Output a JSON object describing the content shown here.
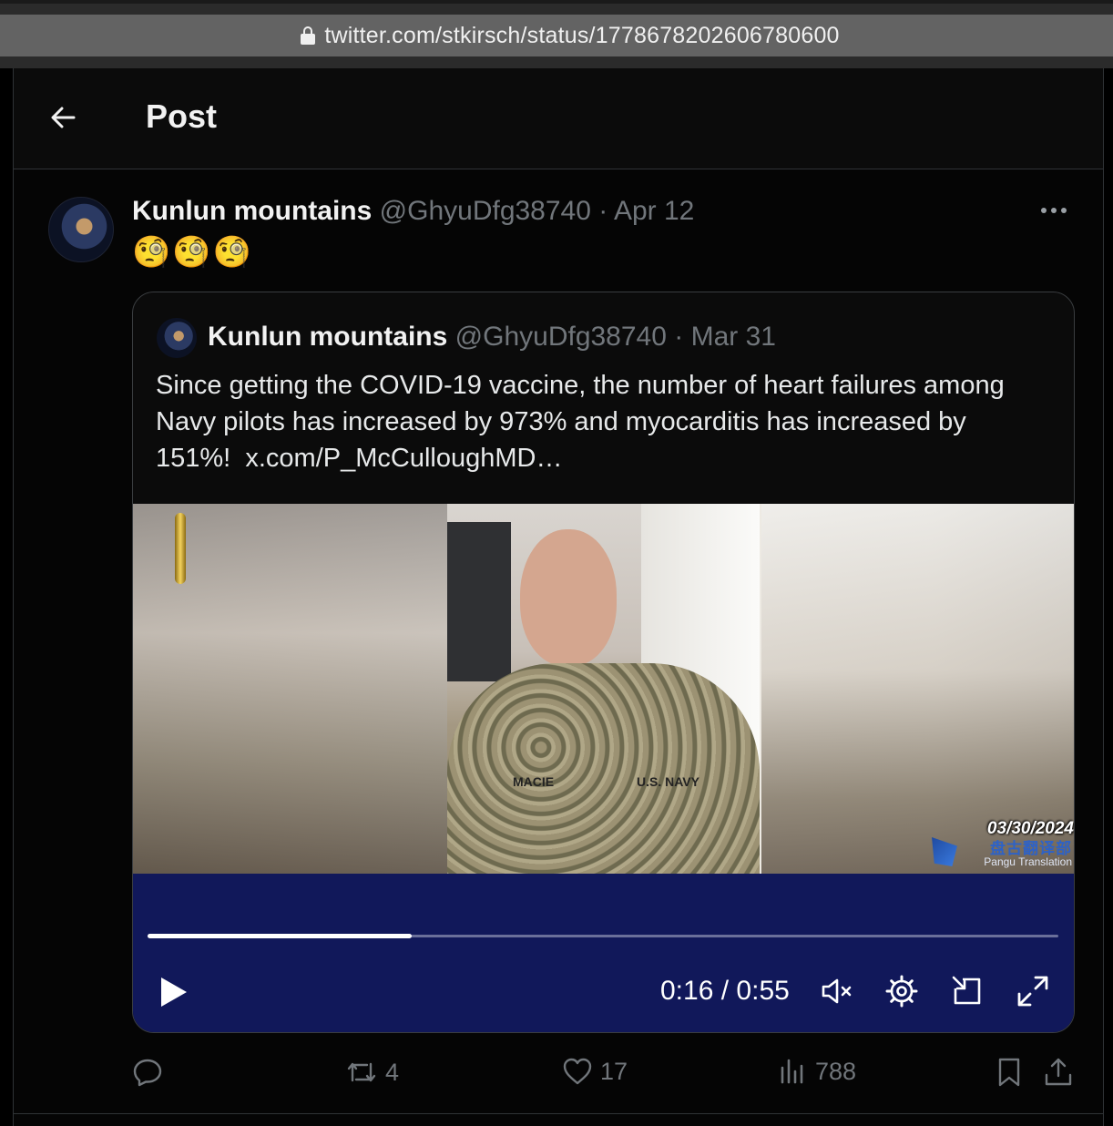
{
  "browser": {
    "url": "twitter.com/stkirsch/status/1778678202606780600"
  },
  "header": {
    "title": "Post"
  },
  "tweet": {
    "author_name": "Kunlun mountains",
    "handle": "@GhyuDfg38740",
    "separator": "·",
    "date": "Apr 12",
    "text": "🧐🧐🧐",
    "quote": {
      "author_name": "Kunlun mountains",
      "handle": "@GhyuDfg38740",
      "separator": "·",
      "date": "Mar 31",
      "text": "Since getting the COVID-19 vaccine, the number of heart failures among Navy pilots has increased by 973% and myocarditis has increased by 151%!",
      "link": "x.com/P_McCulloughMD…",
      "video": {
        "overlay_name_left": "MACIE",
        "overlay_name_right": "U.S. NAVY",
        "overlay_date": "03/30/2024",
        "overlay_brand_cn": "盘古翻译部",
        "overlay_brand_en": "Pangu Translation",
        "time_current": "0:16",
        "time_separator": "/",
        "time_total": "0:55",
        "progress": 0.29,
        "muted": true
      }
    },
    "stats": {
      "replies": "",
      "reposts": "4",
      "likes": "17",
      "views": "788"
    }
  },
  "colors": {
    "background": "#000000",
    "muted_text": "#71767b",
    "video_panel": "#11185a",
    "border": "#2f3336"
  },
  "icons": {
    "back": "arrow-left-icon",
    "more": "more-horizontal-icon",
    "play": "play-icon",
    "volume": "volume-muted-icon",
    "settings": "gear-icon",
    "pip": "picture-in-picture-icon",
    "fullscreen": "fullscreen-icon",
    "reply": "reply-icon",
    "repost": "repost-icon",
    "like": "heart-icon",
    "views": "views-icon",
    "bookmark": "bookmark-icon",
    "share": "share-icon"
  }
}
